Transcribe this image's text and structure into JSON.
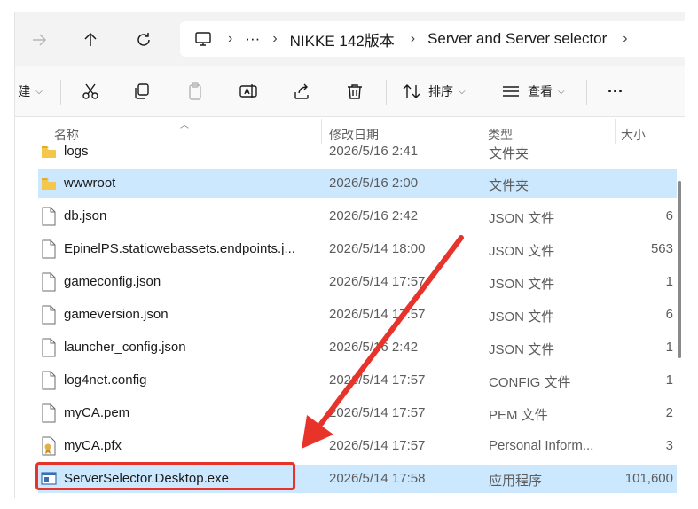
{
  "address": {
    "crumbs": [
      "NIKKE 142版本",
      "Server and Server selector"
    ],
    "more": "···"
  },
  "toolbar": {
    "new_partial": "建",
    "sort_label": "排序",
    "view_label": "查看",
    "more": "···"
  },
  "columns": {
    "name": "名称",
    "date": "修改日期",
    "type": "类型",
    "size": "大小"
  },
  "files": [
    {
      "name": "logs",
      "date": "2026/5/16 2:41",
      "type": "文件夹",
      "size": "",
      "icon": "folder-icon"
    },
    {
      "name": "wwwroot",
      "date": "2026/5/16 2:00",
      "type": "文件夹",
      "size": "",
      "icon": "folder-icon"
    },
    {
      "name": "db.json",
      "date": "2026/5/16 2:42",
      "type": "JSON 文件",
      "size": "6",
      "icon": "file-icon"
    },
    {
      "name": "EpinelPS.staticwebassets.endpoints.j...",
      "date": "2026/5/14 18:00",
      "type": "JSON 文件",
      "size": "563",
      "icon": "file-icon"
    },
    {
      "name": "gameconfig.json",
      "date": "2026/5/14 17:57",
      "type": "JSON 文件",
      "size": "1",
      "icon": "file-icon"
    },
    {
      "name": "gameversion.json",
      "date": "2026/5/14 17:57",
      "type": "JSON 文件",
      "size": "6",
      "icon": "file-icon"
    },
    {
      "name": "launcher_config.json",
      "date": "2026/5/16 2:42",
      "type": "JSON 文件",
      "size": "1",
      "icon": "file-icon"
    },
    {
      "name": "log4net.config",
      "date": "2026/5/14 17:57",
      "type": "CONFIG 文件",
      "size": "1",
      "icon": "file-icon"
    },
    {
      "name": "myCA.pem",
      "date": "2026/5/14 17:57",
      "type": "PEM 文件",
      "size": "2",
      "icon": "file-icon"
    },
    {
      "name": "myCA.pfx",
      "date": "2026/5/14 17:57",
      "type": "Personal Inform...",
      "size": "3",
      "icon": "certificate-icon"
    },
    {
      "name": "ServerSelector.Desktop.exe",
      "date": "2026/5/14 17:58",
      "type": "应用程序",
      "size": "101,600",
      "icon": "exe-icon"
    }
  ],
  "colors": {
    "selection": "#cce8ff",
    "annotation": "#e8332b",
    "folder": "#f4c64a"
  }
}
